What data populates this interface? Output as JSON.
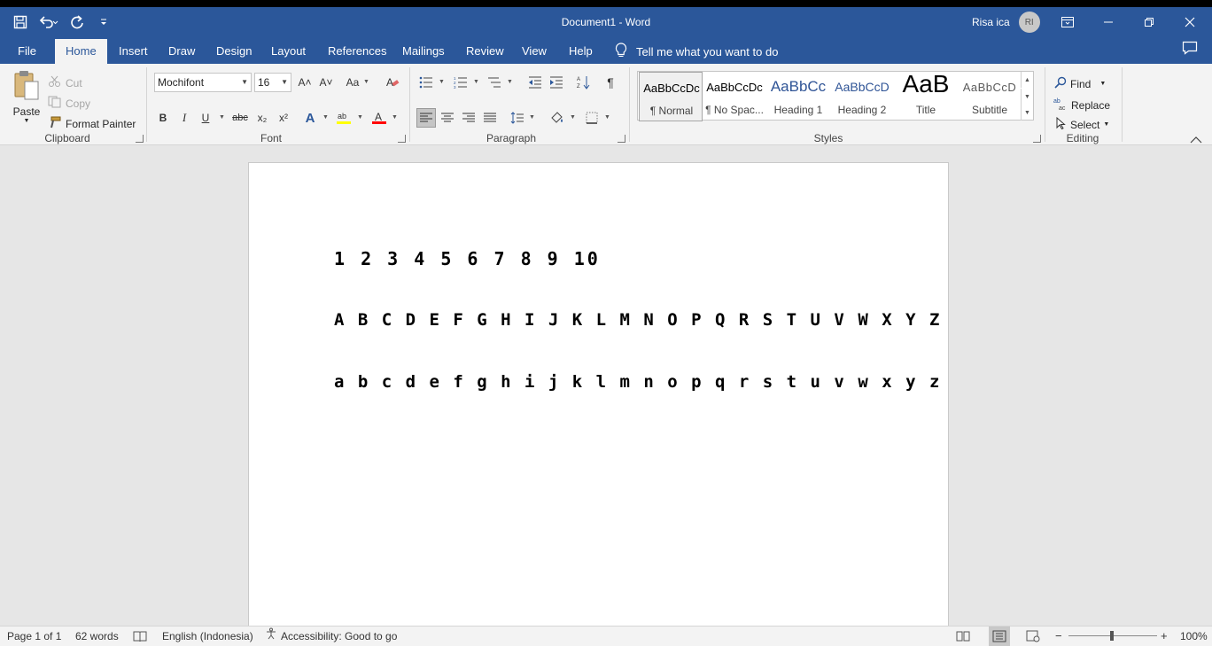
{
  "titlebar": {
    "document_title": "Document1  -  Word",
    "user_name": "Risa ica",
    "user_initials": "RI"
  },
  "tabs": [
    {
      "label": "File"
    },
    {
      "label": "Home"
    },
    {
      "label": "Insert"
    },
    {
      "label": "Draw"
    },
    {
      "label": "Design"
    },
    {
      "label": "Layout"
    },
    {
      "label": "References"
    },
    {
      "label": "Mailings"
    },
    {
      "label": "Review"
    },
    {
      "label": "View"
    },
    {
      "label": "Help"
    }
  ],
  "tell_me": "Tell me what you want to do",
  "clipboard": {
    "paste": "Paste",
    "cut": "Cut",
    "copy": "Copy",
    "format_painter": "Format Painter",
    "label": "Clipboard"
  },
  "font": {
    "name": "Mochifont",
    "size": "16",
    "label": "Font",
    "bold": "B",
    "italic": "I",
    "underline": "U",
    "strike": "abc",
    "sub": "x₂",
    "sup": "x²",
    "change_case": "Aa",
    "grow": "A˄",
    "shrink": "A˅",
    "font_color_letter": "A",
    "text_effects_letter": "A"
  },
  "paragraph": {
    "label": "Paragraph",
    "pilcrow": "¶"
  },
  "styles": {
    "label": "Styles",
    "items": [
      {
        "sample": "AaBbCcDc",
        "name": "¶ Normal"
      },
      {
        "sample": "AaBbCcDc",
        "name": "¶ No Spac..."
      },
      {
        "sample": "AaBbCc",
        "name": "Heading 1"
      },
      {
        "sample": "AaBbCcD",
        "name": "Heading 2"
      },
      {
        "sample": "AaB",
        "name": "Title"
      },
      {
        "sample": "AaBbCcD",
        "name": "Subtitle"
      }
    ]
  },
  "editing": {
    "find": "Find",
    "replace": "Replace",
    "select": "Select",
    "label": "Editing"
  },
  "document": {
    "lines": [
      "1 2 3 4 5 6 7 8 9 10",
      "A B C D E F G H I J K L M N O P Q R S T U V W X Y Z",
      "a b c d e f g h i j k l m n o p q r s t u v w x y z"
    ]
  },
  "status": {
    "page": "Page 1 of 1",
    "words": "62 words",
    "language": "English (Indonesia)",
    "accessibility": "Accessibility: Good to go",
    "zoom": "100%",
    "zoom_minus": "−",
    "zoom_plus": "+"
  },
  "colors": {
    "brand": "#2b579a",
    "ribbon": "#f3f3f3",
    "canvas": "#e6e6e6",
    "highlight": "#ffff00",
    "font_color": "#ff0000"
  }
}
